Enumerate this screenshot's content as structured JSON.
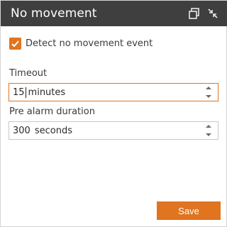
{
  "header": {
    "title": "No movement",
    "icons": [
      "duplicate-windows-icon",
      "collapse-arrows-icon"
    ]
  },
  "detect": {
    "checked": true,
    "label": "Detect no movement event"
  },
  "timeout": {
    "label": "Timeout",
    "value": "15",
    "unit": "minutes"
  },
  "pre_alarm": {
    "label": "Pre alarm duration",
    "value": "300",
    "unit": "seconds"
  },
  "actions": {
    "save_label": "Save"
  },
  "colors": {
    "header_bg": "#3f3f3f",
    "accent": "#e07420"
  }
}
